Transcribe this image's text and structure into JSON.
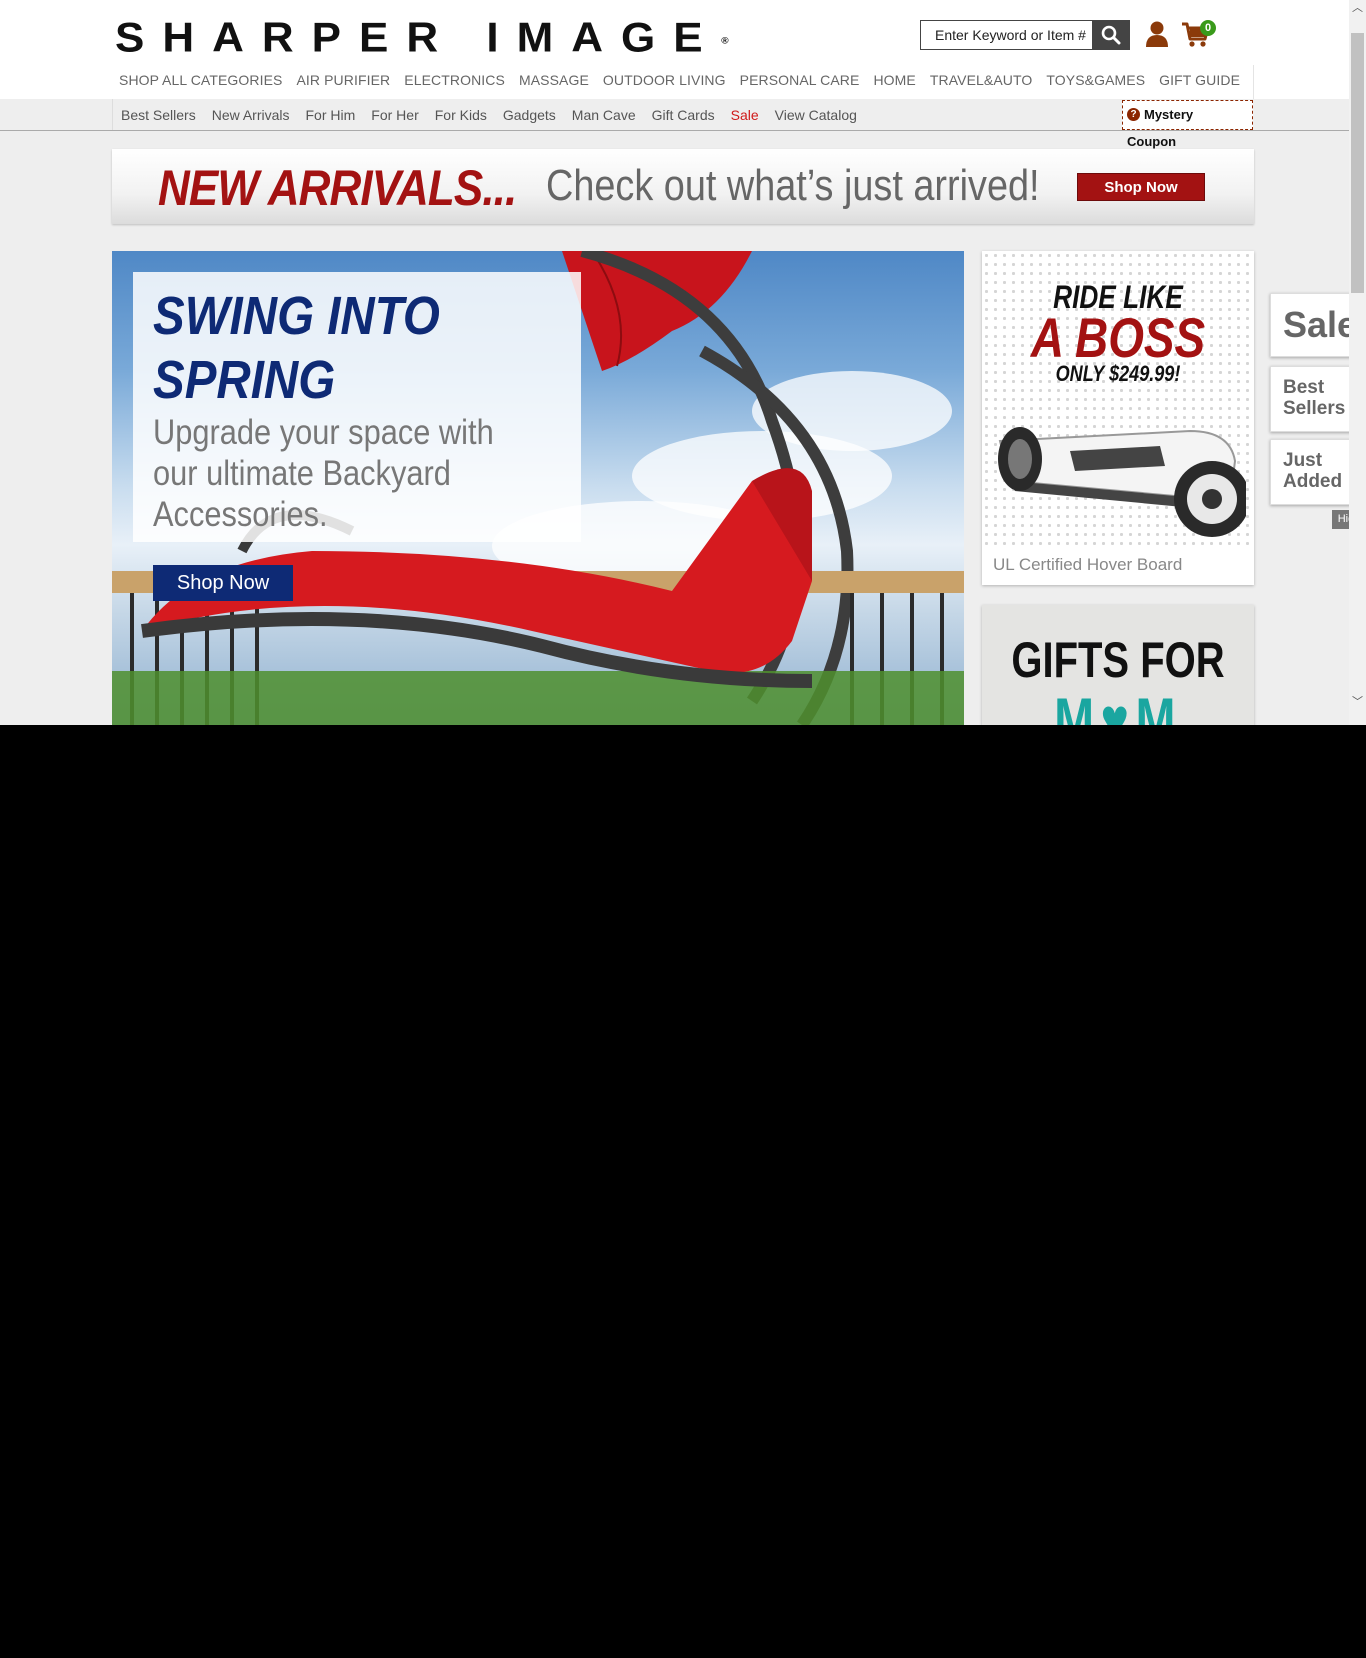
{
  "header": {
    "logo_text": "SHARPER IMAGE",
    "logo_mark": "®",
    "search_placeholder": "Enter Keyword or Item #",
    "cart_count": "0",
    "icons": [
      "search-icon",
      "account-icon",
      "cart-icon"
    ]
  },
  "main_nav": [
    "SHOP ALL CATEGORIES",
    "AIR PURIFIER",
    "ELECTRONICS",
    "MASSAGE",
    "OUTDOOR LIVING",
    "PERSONAL CARE",
    "HOME",
    "TRAVEL&AUTO",
    "TOYS&GAMES",
    "GIFT GUIDE"
  ],
  "sub_nav": [
    "Best Sellers",
    "New Arrivals",
    "For Him",
    "For Her",
    "For Kids",
    "Gadgets",
    "Man Cave",
    "Gift Cards",
    "Sale",
    "View Catalog"
  ],
  "mystery": {
    "line1": "Mystery",
    "line2": "Coupon",
    "icon": "?"
  },
  "arrivals_banner": {
    "headline": "NEW ARRIVALS...",
    "text": "Check out what’s just arrived!",
    "button": "Shop Now"
  },
  "hero": {
    "title": "SWING INTO SPRING",
    "description": "Upgrade your space with our ultimate Backyard Accessories.",
    "button": "Shop Now"
  },
  "ad_hoverboard": {
    "line1": "RIDE LIKE",
    "line2": "A BOSS",
    "line3": "ONLY $249.99!",
    "caption": "UL Certified Hover Board"
  },
  "ad_mom": {
    "line1": "GIFTS FOR",
    "line2": "M♥M"
  },
  "side_tabs": {
    "sale": "Sale",
    "best_sellers": "Best Sellers",
    "just_added": "Just Added",
    "hide": "Hide"
  },
  "colors": {
    "brand_red": "#a31212",
    "navy": "#0e2a75",
    "teal": "#1aa6a0",
    "cart_badge": "#3a9a1a",
    "icon_brown": "#8b3a0a"
  }
}
